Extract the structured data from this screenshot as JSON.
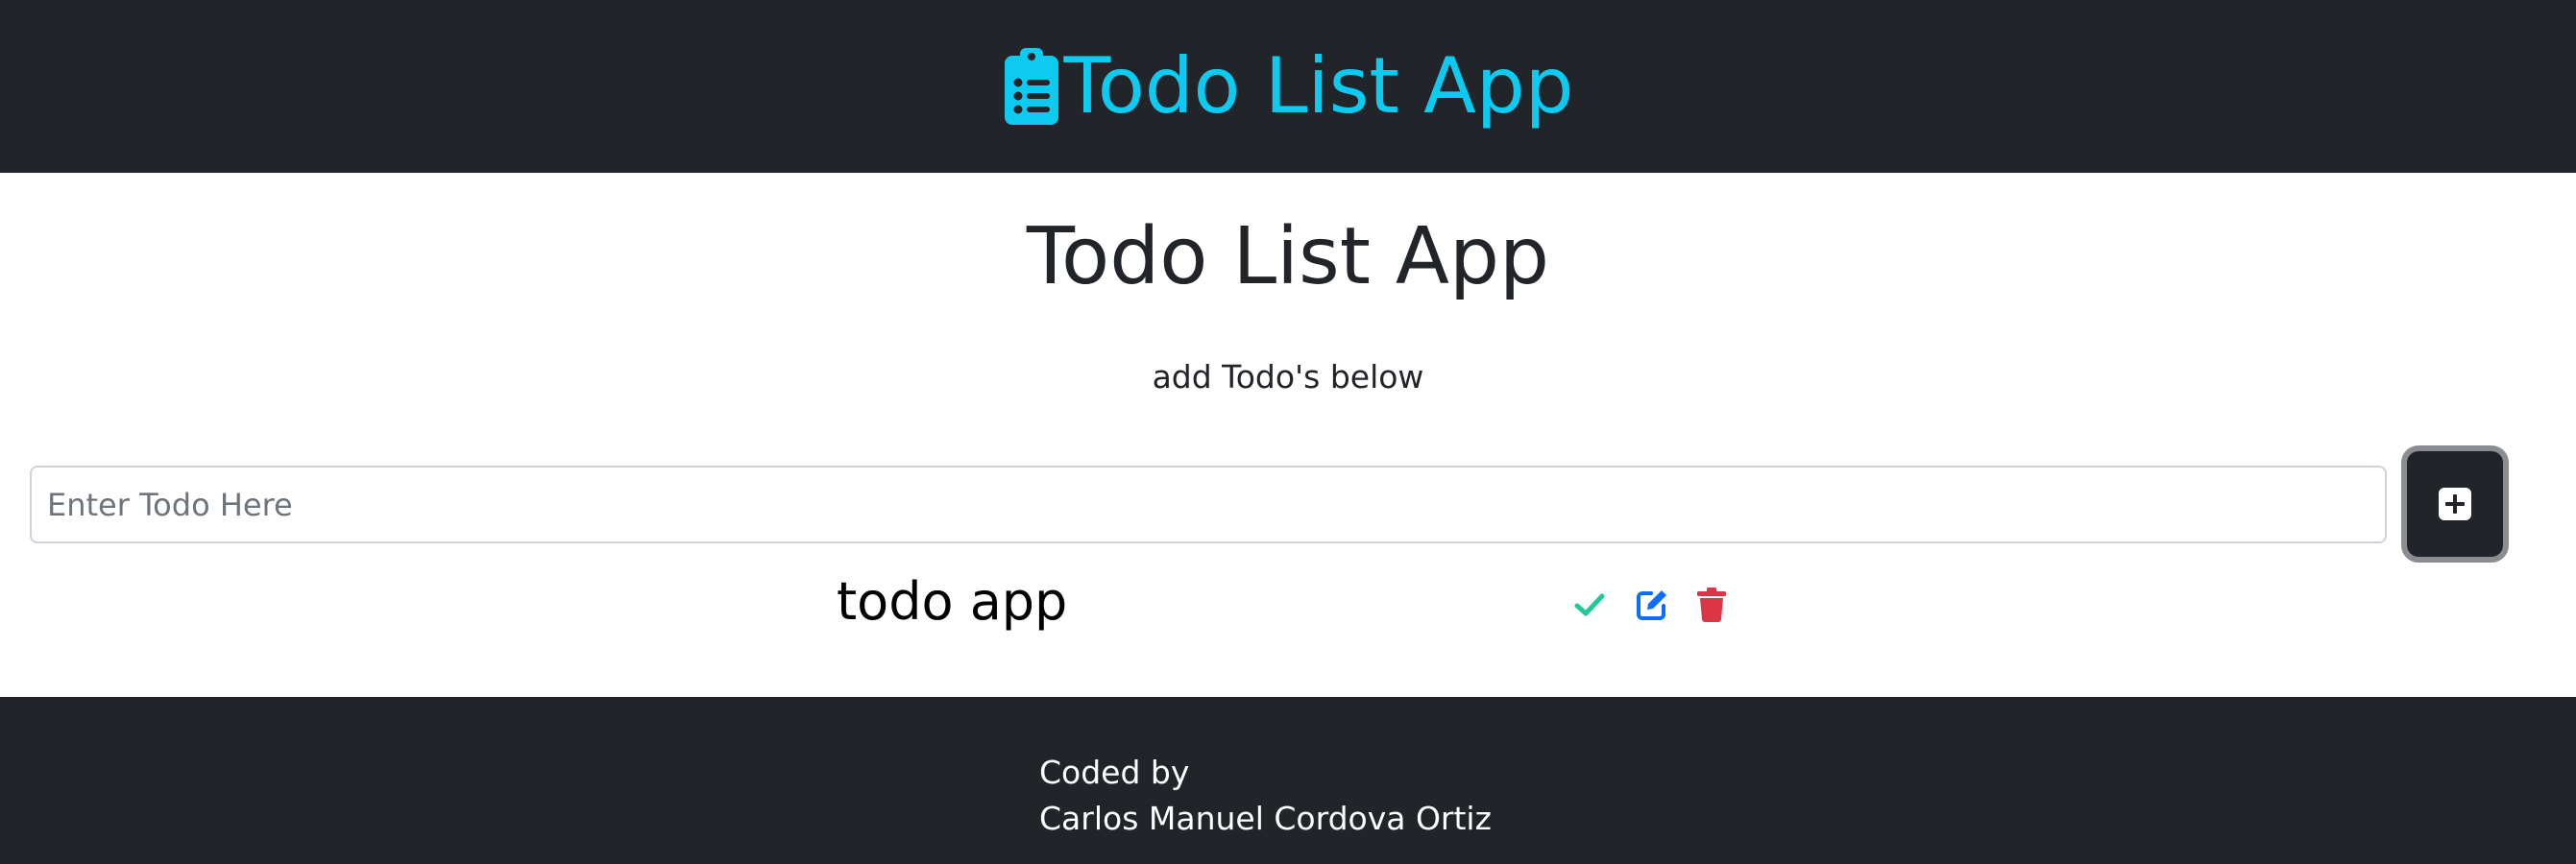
{
  "navbar": {
    "brand_label": "Todo List App",
    "brand_icon": "clipboard-list-icon",
    "brand_color": "#0dcaf0",
    "background": "#212529"
  },
  "main": {
    "title": "Todo List App",
    "subtitle": "add Todo's below"
  },
  "todo_form": {
    "input_value": "",
    "input_placeholder": "Enter Todo Here",
    "add_button_icon": "plus-square-icon"
  },
  "todos": [
    {
      "text": "todo app",
      "actions": [
        {
          "name": "complete",
          "icon": "check-icon",
          "color": "#20c997"
        },
        {
          "name": "edit",
          "icon": "edit-icon",
          "color": "#0d6efd"
        },
        {
          "name": "delete",
          "icon": "trash-icon",
          "color": "#dc3545"
        }
      ]
    }
  ],
  "footer": {
    "line1": "Coded by",
    "line2": "Carlos Manuel Cordova Ortiz"
  }
}
